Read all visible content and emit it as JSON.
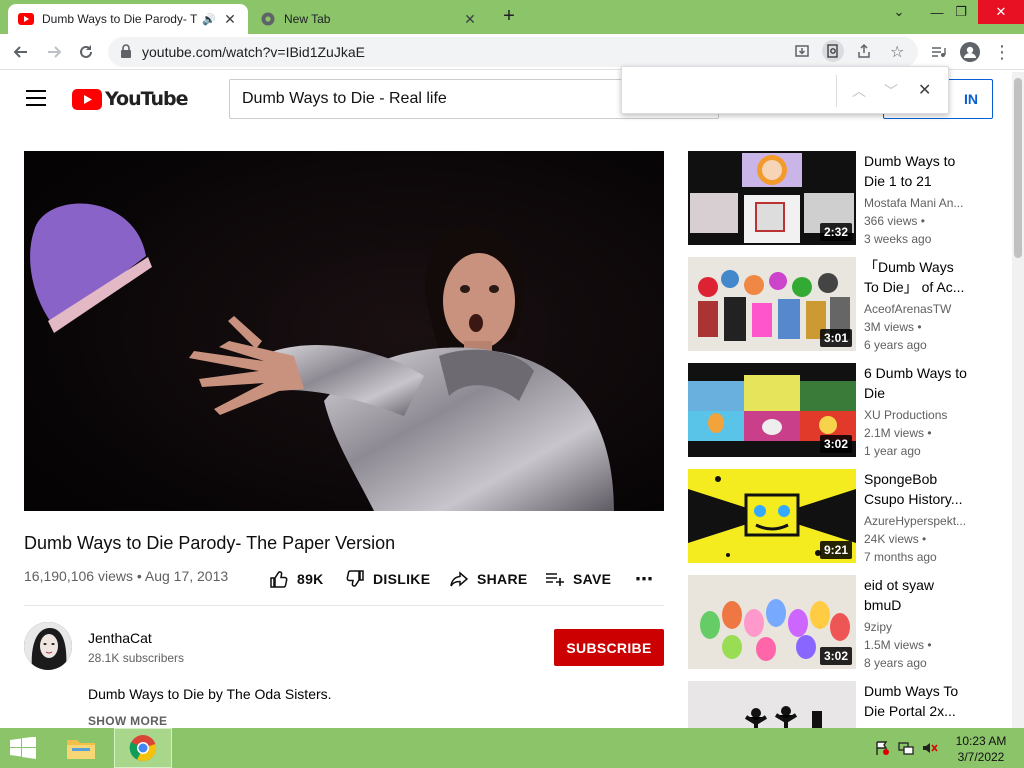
{
  "browser": {
    "tabs": [
      {
        "title": "Dumb Ways to Die Parody- T",
        "icon": "youtube-favicon",
        "active": true
      },
      {
        "title": "New Tab",
        "icon": "chrome-favicon",
        "active": false
      }
    ],
    "url": "youtube.com/watch?v=IBid1ZuJkaE",
    "find_bar": {
      "query": ""
    }
  },
  "youtube": {
    "logo_text": "YouTube",
    "search_value": "Dumb Ways to Die - Real life",
    "sign_in_label": "IN"
  },
  "video": {
    "title": "Dumb Ways to Die Parody- The Paper Version",
    "views_date": "16,190,106 views • Aug 17, 2013",
    "actions": {
      "like": "89K",
      "dislike": "DISLIKE",
      "share": "SHARE",
      "save": "SAVE"
    },
    "channel": "JenthaCat",
    "subscribers": "28.1K subscribers",
    "subscribe_label": "SUBSCRIBE",
    "description": "Dumb Ways to Die by The Oda Sisters.",
    "show_more": "SHOW MORE"
  },
  "recommendations": [
    {
      "title": "Dumb Ways to Die 1 to 21",
      "channel": "Mostafa Mani An...",
      "views": "366 views •",
      "age": "3 weeks ago",
      "duration": "2:32"
    },
    {
      "title": "「Dumb Ways To Die」 of Ac...",
      "channel": "AceofArenasTW",
      "views": "3M views •",
      "age": "6 years ago",
      "duration": "3:01"
    },
    {
      "title": "6 Dumb Ways to Die",
      "channel": "XU Productions",
      "views": "2.1M views •",
      "age": "1 year ago",
      "duration": "3:02"
    },
    {
      "title": "SpongeBob Csupo History...",
      "channel": "AzureHyperspekt...",
      "views": "24K views •",
      "age": "7 months ago",
      "duration": "9:21"
    },
    {
      "title": "eid ot syaw bmuD",
      "channel": "9zipy",
      "views": "1.5M views •",
      "age": "8 years ago",
      "duration": "3:02"
    },
    {
      "title": "Dumb Ways To Die Portal 2x...",
      "channel": "",
      "views": "",
      "age": "",
      "duration": ""
    }
  ],
  "taskbar": {
    "time": "10:23 AM",
    "date": "3/7/2022"
  },
  "colors": {
    "chrome_frame": "#8cc46a",
    "yt_red": "#ff0000",
    "subscribe_red": "#cc0000",
    "link_blue": "#065fd4"
  }
}
